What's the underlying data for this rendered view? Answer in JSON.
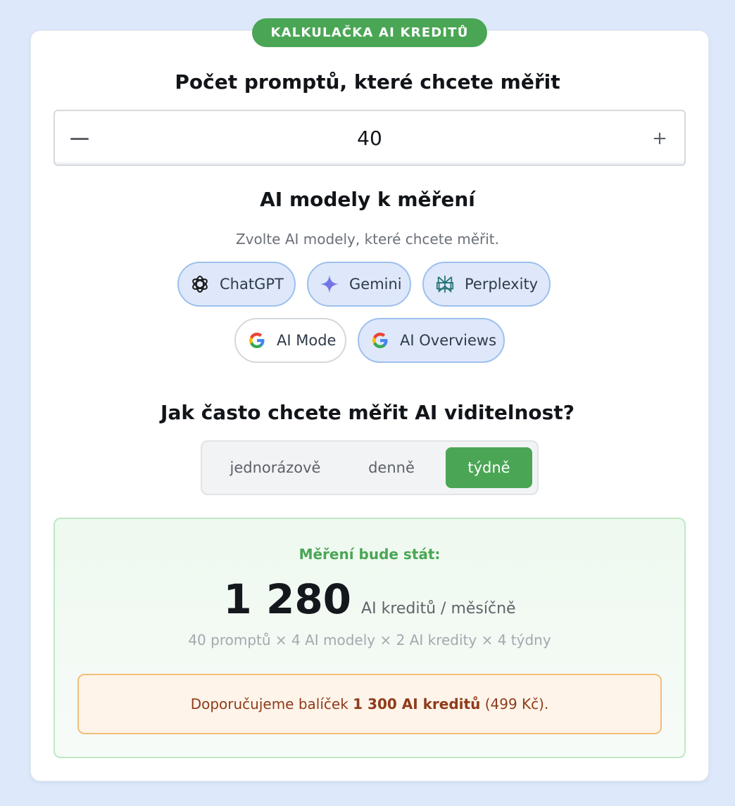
{
  "badge": "KALKULAČKA AI KREDITŮ",
  "prompts": {
    "heading": "Počet promptů, které chcete měřit",
    "value": "40",
    "plus": "+"
  },
  "models": {
    "heading": "AI modely k měření",
    "subtitle": "Zvolte AI modely, které chcete měřit.",
    "items": [
      {
        "label": "ChatGPT",
        "icon": "chatgpt-icon",
        "selected": true
      },
      {
        "label": "Gemini",
        "icon": "gemini-icon",
        "selected": true
      },
      {
        "label": "Perplexity",
        "icon": "perplexity-icon",
        "selected": true
      },
      {
        "label": "AI Mode",
        "icon": "google-icon",
        "selected": false
      },
      {
        "label": "AI Overviews",
        "icon": "google-icon",
        "selected": true
      }
    ]
  },
  "frequency": {
    "heading": "Jak často chcete měřit AI viditelnost?",
    "options": [
      "jednorázově",
      "denně",
      "týdně"
    ],
    "selected": "týdně"
  },
  "result": {
    "label": "Měření bude stát:",
    "value": "1 280",
    "unit": "AI kreditů / měsíčně",
    "formula": "40 promptů × 4 AI modely × 2 AI kredity × 4 týdny",
    "reco_prefix": "Doporučujeme balíček",
    "reco_package": "1 300 AI kreditů",
    "reco_price": "(499 Kč)."
  },
  "colors": {
    "accent_green": "#4aa655",
    "chip_selected_bg": "#dfe8fa",
    "chip_selected_border": "#9cc0ee",
    "page_bg": "#dde8fb",
    "reco_text": "#8f3b1a"
  }
}
